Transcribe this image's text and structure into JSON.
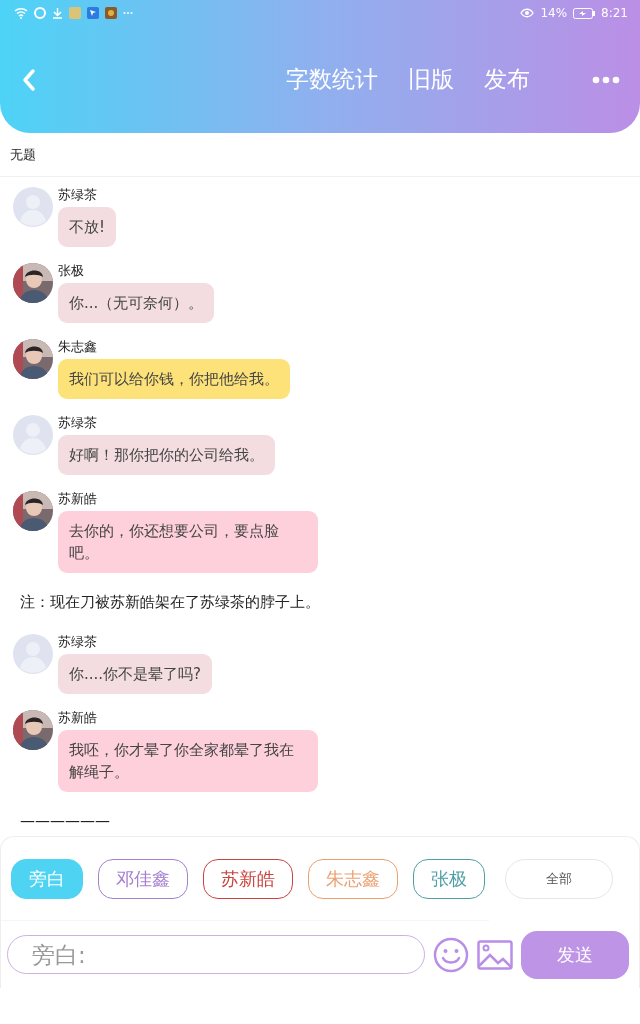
{
  "status_bar": {
    "battery": "14%",
    "time": "8:21"
  },
  "header": {
    "actions": [
      "字数统计",
      "旧版",
      "发布"
    ]
  },
  "title": "无题",
  "entries": [
    {
      "kind": "message",
      "name": "苏绿茶",
      "avatar": {
        "kind": "placeholder"
      },
      "text": "不放!",
      "color": "#f3dde0"
    },
    {
      "kind": "message",
      "name": "张极",
      "text": "你...（无可奈何）。",
      "color": "#f3dde0"
    },
    {
      "kind": "message",
      "name": "朱志鑫",
      "text": "我们可以给你钱，你把他给我。",
      "color": "#fde27a"
    },
    {
      "kind": "message",
      "name": "苏绿茶",
      "avatar": {
        "kind": "placeholder"
      },
      "text": "好啊！那你把你的公司给我。",
      "color": "#f3dde0"
    },
    {
      "kind": "message",
      "name": "苏新皓",
      "text": "去你的，你还想要公司，要点脸吧。",
      "color": "#fdd0dc"
    },
    {
      "kind": "note",
      "text": "注：现在刀被苏新皓架在了苏绿茶的脖子上。"
    },
    {
      "kind": "message",
      "name": "苏绿茶",
      "avatar": {
        "kind": "placeholder"
      },
      "text": "你....你不是晕了吗?",
      "color": "#f3dde0"
    },
    {
      "kind": "message",
      "name": "苏新皓",
      "text": "我呸，你才晕了你全家都晕了我在解绳子。",
      "color": "#fdd0dc"
    },
    {
      "kind": "note",
      "text": "——————"
    }
  ],
  "characters": [
    {
      "label": "旁白",
      "color": "#4fd3f2",
      "selected": true
    },
    {
      "label": "邓佳鑫",
      "color": "#a57fd0",
      "selected": false
    },
    {
      "label": "苏新皓",
      "color": "#c9433f",
      "selected": false
    },
    {
      "label": "朱志鑫",
      "color": "#eba070",
      "selected": false
    },
    {
      "label": "张极",
      "color": "#4f9fa6",
      "selected": false
    }
  ],
  "all_button": "全部",
  "composer": {
    "placeholder": "旁白:",
    "send": "发送"
  }
}
